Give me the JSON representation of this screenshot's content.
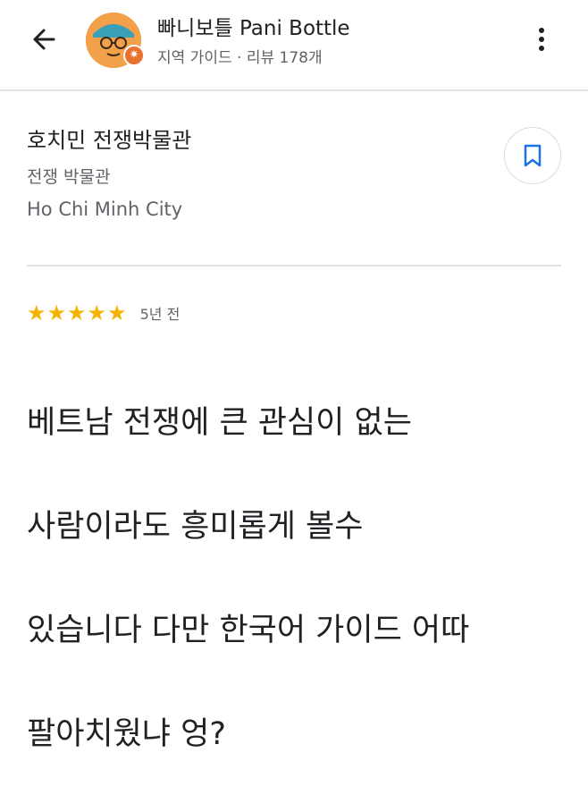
{
  "header": {
    "profile_name": "빠니보틀 Pani Bottle",
    "profile_meta": "지역 가이드 · 리뷰 178개"
  },
  "place": {
    "name": "호치민 전쟁박물관",
    "category": "전쟁 박물관",
    "city": "Ho Chi Minh City"
  },
  "review": {
    "stars": "★★★★★",
    "rating": 5,
    "time": "5년 전",
    "lines": [
      "베트남 전쟁에 큰 관심이 없는",
      "사람이라도 흥미롭게 볼수",
      "있습니다 다만 한국어 가이드 어따",
      "팔아치웠냐 엉?"
    ]
  },
  "colors": {
    "accent_blue": "#1a73e8",
    "star_yellow": "#f4b400",
    "badge_orange": "#e8712d"
  },
  "icons": [
    "back-arrow-icon",
    "local-guide-badge-icon",
    "more-vert-icon",
    "bookmark-icon",
    "star-icon"
  ]
}
